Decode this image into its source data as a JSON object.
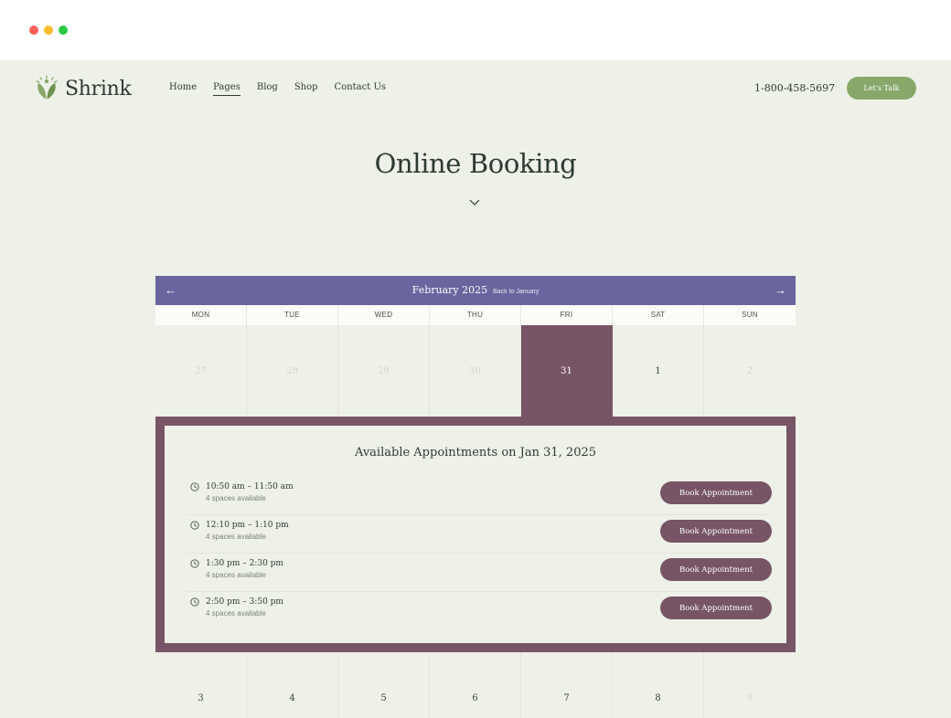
{
  "brand": {
    "name": "Shrink",
    "accent": "#87a86a",
    "calendar_header": "#69659e",
    "selected": "#775566"
  },
  "nav": {
    "items": [
      {
        "label": "Home",
        "active": false
      },
      {
        "label": "Pages",
        "active": true
      },
      {
        "label": "Blog",
        "active": false
      },
      {
        "label": "Shop",
        "active": false
      },
      {
        "label": "Contact Us",
        "active": false
      }
    ]
  },
  "header": {
    "phone": "1-800-458-5697",
    "cta_label": "Let's Talk"
  },
  "hero": {
    "title": "Online Booking",
    "icon": "chevron-down-icon"
  },
  "calendar": {
    "prev_icon": "←",
    "next_icon": "→",
    "month_label": "February 2025",
    "back_label": "Back to January",
    "weekdays": [
      "MON",
      "TUE",
      "WED",
      "THU",
      "FRI",
      "SAT",
      "SUN"
    ],
    "week1": [
      "27",
      "28",
      "29",
      "30",
      "31",
      "1",
      "2"
    ],
    "week2": [
      "3",
      "4",
      "5",
      "6",
      "7",
      "8",
      "9"
    ]
  },
  "appointments": {
    "title": "Available Appointments on Jan 31, 2025",
    "slots": [
      {
        "time": "10:50 am – 11:50 am",
        "spaces": "4 spaces available",
        "button": "Book Appointment"
      },
      {
        "time": "12:10 pm – 1:10 pm",
        "spaces": "4 spaces available",
        "button": "Book Appointment"
      },
      {
        "time": "1:30 pm – 2:30 pm",
        "spaces": "4 spaces available",
        "button": "Book Appointment"
      },
      {
        "time": "2:50 pm – 3:50 pm",
        "spaces": "4 spaces available",
        "button": "Book Appointment"
      }
    ]
  }
}
